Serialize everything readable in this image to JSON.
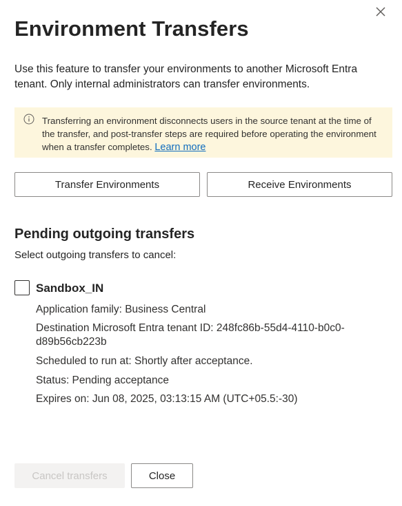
{
  "dialog": {
    "title": "Environment Transfers",
    "intro": "Use this feature to transfer your environments to another Microsoft Entra tenant. Only internal administrators can transfer environments.",
    "close_icon": "close-icon"
  },
  "info": {
    "icon": "info-icon",
    "message": "Transferring an environment disconnects users in the source tenant at the time of the transfer, and post-transfer steps are required before operating the environment when a transfer completes.",
    "link_label": "Learn more",
    "background_color": "#fdf6dd"
  },
  "actions": {
    "transfer_label": "Transfer Environments",
    "receive_label": "Receive Environments"
  },
  "pending": {
    "section_title": "Pending outgoing transfers",
    "instruction": "Select outgoing transfers to cancel:",
    "items": [
      {
        "name": "Sandbox_IN",
        "checked": false,
        "application_family": "Application family: Business Central",
        "destination": "Destination Microsoft Entra tenant ID: 248fc86b-55d4-4110-b0c0-d89b56cb223b",
        "scheduled": "Scheduled to run at: Shortly after acceptance.",
        "status": "Status: Pending acceptance",
        "expires": "Expires on: Jun 08, 2025, 03:13:15 AM (UTC+05.5:-30)"
      }
    ]
  },
  "footer": {
    "cancel_label": "Cancel transfers",
    "cancel_disabled": true,
    "close_label": "Close"
  },
  "colors": {
    "link": "#0f6cbd",
    "disabled_text": "#c8c6c4",
    "disabled_bg": "#f3f2f1"
  }
}
